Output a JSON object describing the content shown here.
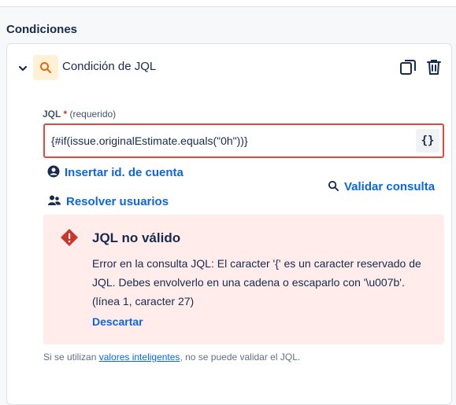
{
  "section": {
    "title": "Condiciones"
  },
  "condition": {
    "title": "Condición de JQL",
    "icons": {
      "expand": "chevron-down-icon",
      "type": "search-icon",
      "copy": "copy-icon",
      "delete": "trash-icon"
    }
  },
  "jql": {
    "label": "JQL",
    "required_mark": "*",
    "required_text": "(requerido)",
    "value": "{#if(issue.originalEstimate.equals(\"0h\"))}",
    "brace_button": "{}"
  },
  "links": {
    "insert_account_id": "Insertar id. de cuenta",
    "resolve_users": "Resolver usuarios",
    "validate_query": "Validar consulta"
  },
  "error": {
    "title": "JQL no válido",
    "message": "Error en la consulta JQL: El caracter '{' es un caracter reservado de JQL. Debes envolverlo en una cadena o escaparlo con '\\u007b'. (línea 1, caracter 27)",
    "dismiss": "Descartar"
  },
  "footnote": {
    "prefix": "Si se utilizan ",
    "link": "valores inteligentes",
    "suffix": ", no se puede validar el JQL."
  },
  "colors": {
    "link": "#0c66e4",
    "error_bg": "#ffeceb",
    "error_border": "#e2483d",
    "icon_bg": "#fff1d6",
    "icon_orange": "#e56910"
  }
}
